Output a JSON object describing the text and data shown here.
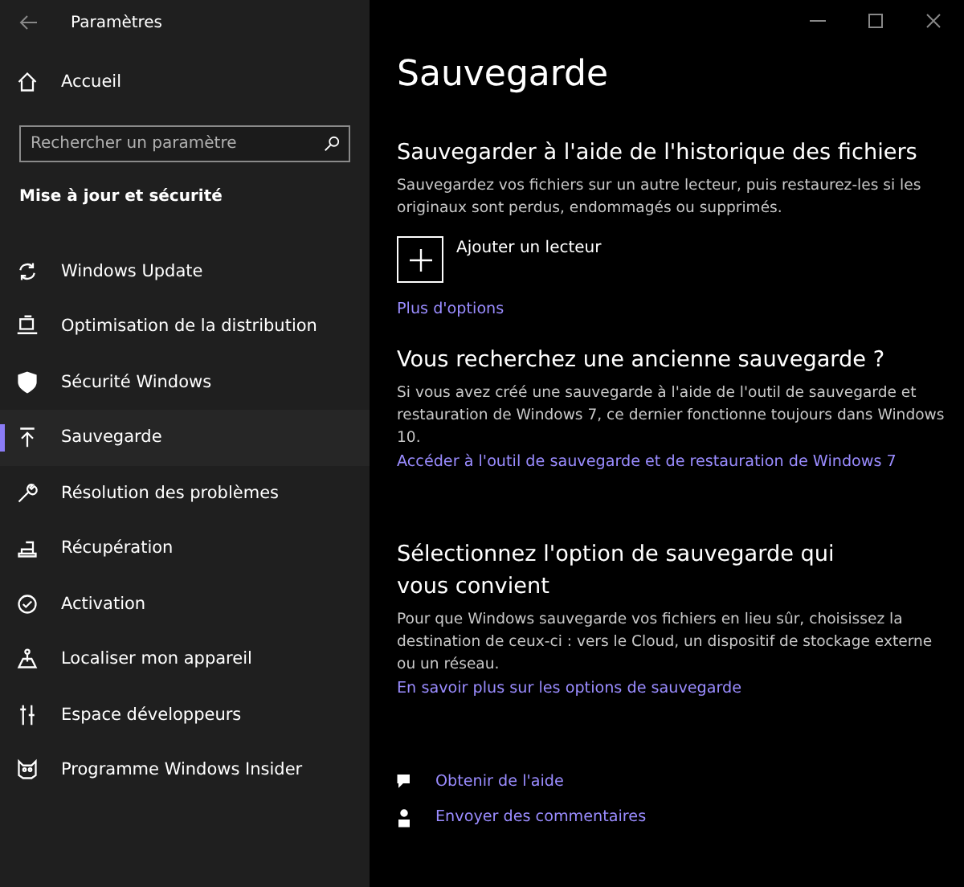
{
  "window": {
    "title": "Paramètres"
  },
  "sidebar": {
    "home": "Accueil",
    "search": {
      "placeholder": "Rechercher un paramètre"
    },
    "section": "Mise à jour et sécurité",
    "items": [
      {
        "label": "Windows Update",
        "selected": false
      },
      {
        "label": "Optimisation de la distribution",
        "selected": false
      },
      {
        "label": "Sécurité Windows",
        "selected": false
      },
      {
        "label": "Sauvegarde",
        "selected": true
      },
      {
        "label": "Résolution des problèmes",
        "selected": false
      },
      {
        "label": "Récupération",
        "selected": false
      },
      {
        "label": "Activation",
        "selected": false
      },
      {
        "label": "Localiser mon appareil",
        "selected": false
      },
      {
        "label": "Espace développeurs",
        "selected": false
      },
      {
        "label": "Programme Windows Insider",
        "selected": false
      }
    ]
  },
  "page": {
    "title": "Sauvegarde",
    "sections": [
      {
        "heading": "Sauvegarder à l'aide de l'historique des fichiers",
        "text": "Sauvegardez vos fichiers sur un autre lecteur, puis restaurez-les si les originaux sont perdus, endommagés ou supprimés.",
        "add_button": "Ajouter un lecteur",
        "link": "Plus d'options"
      },
      {
        "heading": "Vous recherchez une ancienne sauvegarde ?",
        "text": "Si vous avez créé une sauvegarde à l'aide de l'outil de sauvegarde et restauration de Windows 7, ce dernier fonctionne toujours dans Windows 10.",
        "link": "Accéder à l'outil de sauvegarde et de restauration de Windows 7"
      },
      {
        "heading": "Sélectionnez l'option de sauvegarde qui vous convient",
        "text": "Pour que Windows sauvegarde vos fichiers en lieu sûr, choisissez la destination de ceux-ci : vers le Cloud, un dispositif de stockage externe ou un réseau.",
        "link": "En savoir plus sur les options de sauvegarde"
      }
    ],
    "help_links": [
      "Obtenir de l'aide",
      "Envoyer des commentaires"
    ]
  }
}
